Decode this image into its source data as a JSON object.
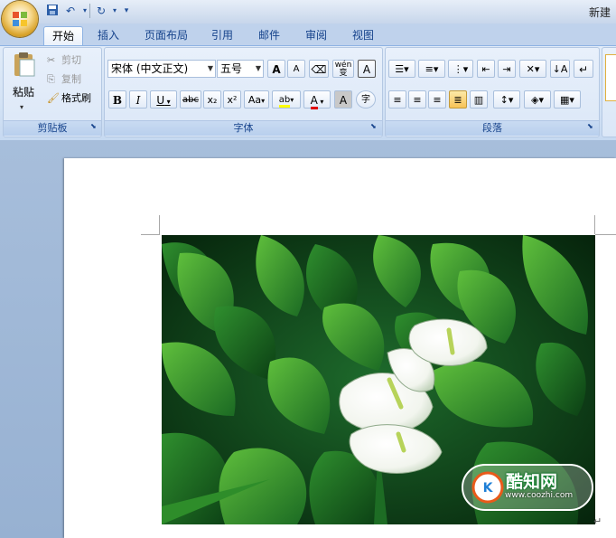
{
  "window": {
    "title": "新建"
  },
  "tabs": [
    {
      "label": "开始",
      "active": true
    },
    {
      "label": "插入"
    },
    {
      "label": "页面布局"
    },
    {
      "label": "引用"
    },
    {
      "label": "邮件"
    },
    {
      "label": "审阅"
    },
    {
      "label": "视图"
    }
  ],
  "clipboard": {
    "paste": "粘贴",
    "cut": "剪切",
    "copy": "复制",
    "format_painter": "格式刷",
    "group_label": "剪贴板"
  },
  "font": {
    "family": "宋体 (中文正文)",
    "size": "五号",
    "grow": "A",
    "shrink": "A",
    "bold": "B",
    "italic": "I",
    "underline": "U",
    "strike": "abc",
    "subscript": "x₂",
    "superscript": "x²",
    "change_case": "Aa",
    "highlight": "ab",
    "font_color": "A",
    "char_shading": "A",
    "enclose": "字",
    "phonetic": "wén",
    "phonetic_char": "变",
    "char_border": "A",
    "group_label": "字体"
  },
  "paragraph": {
    "group_label": "段落"
  },
  "watermark": {
    "site": "酷知网",
    "url": "www.coozhi.com"
  },
  "colors": {
    "accent": "#15428b",
    "highlight_yellow": "#ffff00",
    "font_red": "#e00000"
  }
}
